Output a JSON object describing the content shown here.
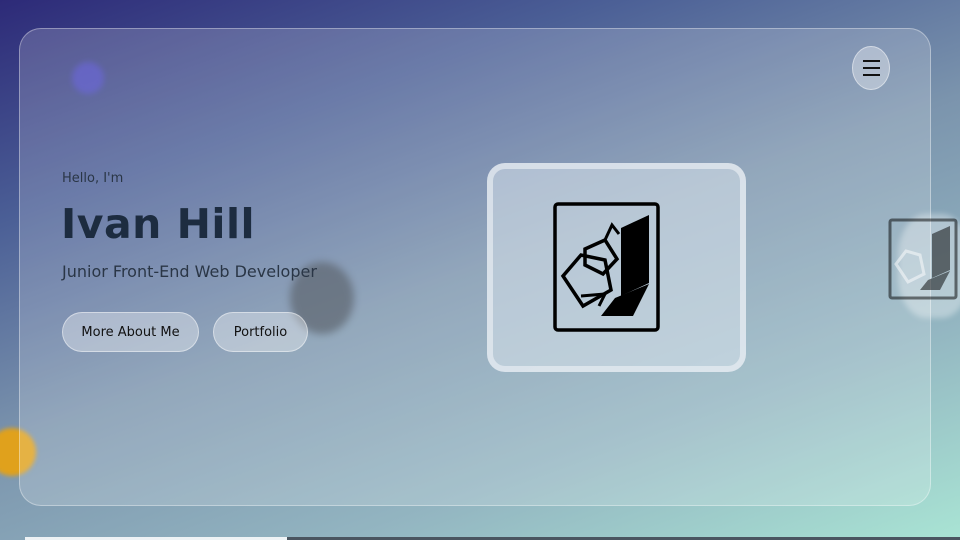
{
  "hero": {
    "greeting": "Hello, I'm",
    "name": "Ivan Hill",
    "role": "Junior Front-End Web Developer"
  },
  "buttons": {
    "about": "More About Me",
    "portfolio": "Portfolio"
  },
  "icons": {
    "menu": "hamburger-menu-icon",
    "logo": "geometric-logo-icon"
  },
  "colors": {
    "name_text": "#1d2c40",
    "gradient_start": "#2d2a78",
    "gradient_end": "#a9e4d4",
    "accent_gold": "#e0a11c"
  }
}
